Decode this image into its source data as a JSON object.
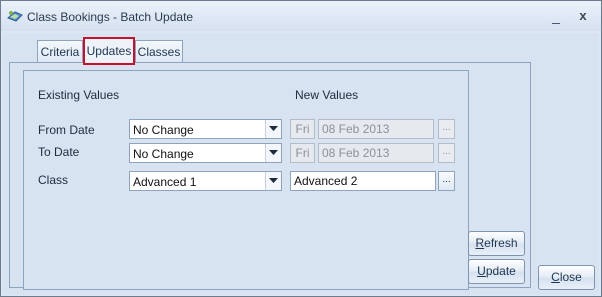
{
  "window": {
    "title": "Class Bookings - Batch Update",
    "minimize_glyph": "_",
    "close_glyph": "x"
  },
  "tabs": [
    {
      "label": "Criteria",
      "selected": false
    },
    {
      "label": "Updates",
      "selected": true
    },
    {
      "label": "Classes",
      "selected": false
    }
  ],
  "updates": {
    "existing_header": "Existing Values",
    "new_header": "New Values",
    "rows": [
      {
        "label": "From Date",
        "existing": "No Change",
        "day": "Fri",
        "date": "08 Feb 2013",
        "ellipsis": "..."
      },
      {
        "label": "To Date",
        "existing": "No Change",
        "day": "Fri",
        "date": "08 Feb 2013",
        "ellipsis": "..."
      },
      {
        "label": "Class",
        "existing": "Advanced 1",
        "new": "Advanced 2",
        "ellipsis": "..."
      }
    ]
  },
  "buttons": {
    "refresh": {
      "mnemonic": "R",
      "rest": "efresh"
    },
    "update": {
      "mnemonic": "U",
      "rest": "pdate"
    },
    "close": {
      "mnemonic": "C",
      "rest": "lose"
    }
  },
  "colors": {
    "selected_tab_highlight": "#c8102e",
    "window_background": "#d7e3f1"
  },
  "icons": [
    "app-icon",
    "minimize-icon",
    "close-icon",
    "dropdown-arrow-icon"
  ]
}
